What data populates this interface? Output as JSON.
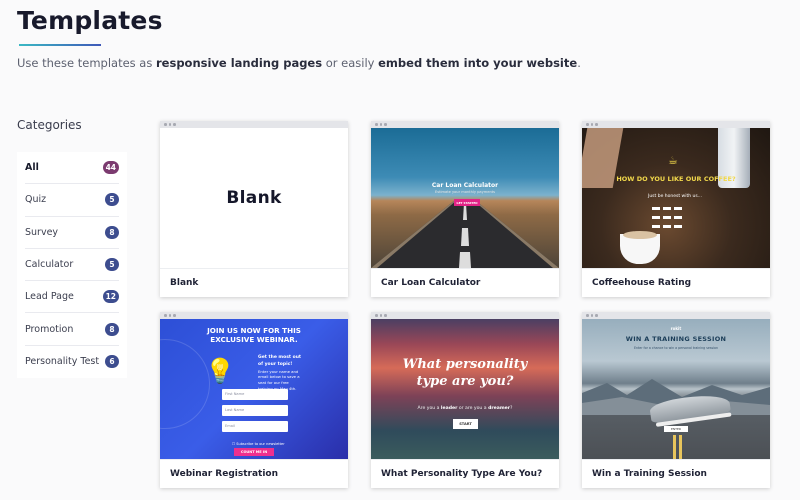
{
  "header": {
    "title": "Templates",
    "subtitle_prefix": "Use these templates as",
    "subtitle_bold_1": "responsive landing pages",
    "subtitle_mid": "or easily",
    "subtitle_bold_2": "embed them into your website",
    "subtitle_suffix": "."
  },
  "sidebar": {
    "heading": "Categories",
    "items": [
      {
        "label": "All",
        "count": "44"
      },
      {
        "label": "Quiz",
        "count": "5"
      },
      {
        "label": "Survey",
        "count": "8"
      },
      {
        "label": "Calculator",
        "count": "5"
      },
      {
        "label": "Lead Page",
        "count": "12"
      },
      {
        "label": "Promotion",
        "count": "8"
      },
      {
        "label": "Personality Test",
        "count": "6"
      }
    ]
  },
  "cards": [
    {
      "title": "Blank",
      "preview_text": "Blank"
    },
    {
      "title": "Car Loan Calculator",
      "preview_title": "Car Loan Calculator",
      "preview_sub": "Estimate your monthly payments",
      "preview_button": "GET STARTED"
    },
    {
      "title": "Coffeehouse Rating",
      "preview_title": "HOW DO YOU LIKE OUR COFFEE?",
      "preview_sub": "Just be honest with us..."
    },
    {
      "title": "Webinar Registration",
      "preview_title_1": "JOIN US NOW FOR THIS",
      "preview_title_2": "EXCLUSIVE WEBINAR.",
      "preview_body_head": "Get the most out of your topic!",
      "preview_body": "Enter your name and email below to save a seat for our free training on May 4th.",
      "field_1": "First Name",
      "field_2": "Last Name",
      "field_3": "Email",
      "checkbox_label": "Subscribe to our newsletter",
      "preview_button": "COUNT ME IN"
    },
    {
      "title": "What Personality Type Are You?",
      "preview_title_1": "What personality",
      "preview_title_2": "type are you?",
      "preview_sub_1": "Are you a",
      "preview_sub_bold_1": "leader",
      "preview_sub_2": "or are you a",
      "preview_sub_bold_2": "dreamer",
      "preview_sub_3": "?",
      "preview_button": "START"
    },
    {
      "title": "Win a Training Session",
      "preview_logo": "rokit",
      "preview_title": "WIN A TRAINING SESSION",
      "preview_desc": "Enter for a chance to win a personal training session",
      "preview_button": "ENTER"
    }
  ]
}
